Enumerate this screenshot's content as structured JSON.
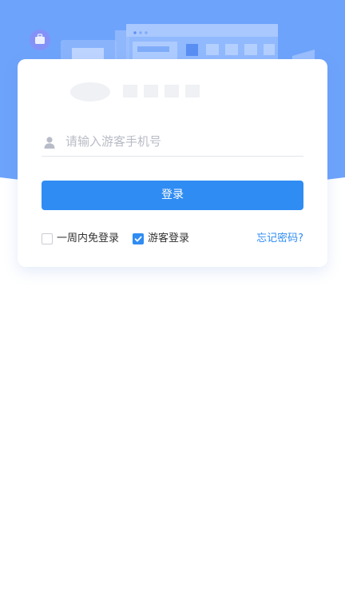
{
  "login": {
    "phone_placeholder": "请输入游客手机号",
    "phone_value": "",
    "submit_label": "登录",
    "remember_label": "一周内免登录",
    "remember_checked": false,
    "guest_label": "游客登录",
    "guest_checked": true,
    "forgot_label": "忘记密码?"
  },
  "icons": {
    "user": "user-icon",
    "checkmark": "check-icon",
    "briefcase": "briefcase-icon"
  },
  "colors": {
    "primary": "#2f8cf3",
    "hero_background": "#6ea3fb",
    "card_background": "#ffffff",
    "placeholder": "#b9bcc6",
    "link": "#2f8cf3"
  }
}
